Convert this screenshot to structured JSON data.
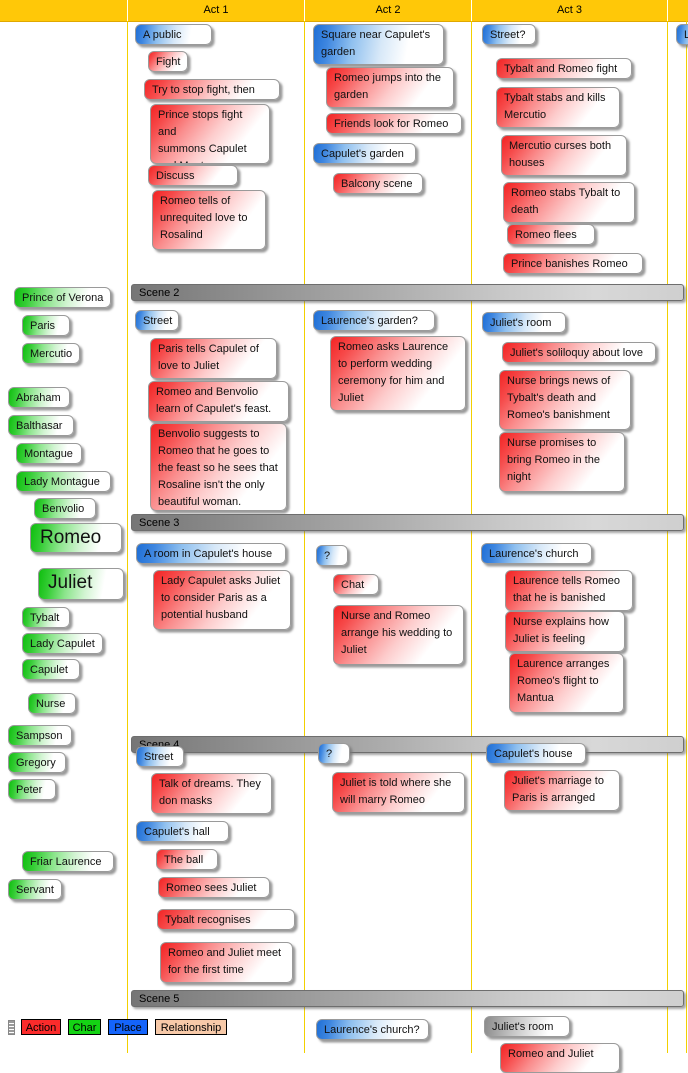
{
  "header": {
    "columns": [
      {
        "label": ""
      },
      {
        "label": "Act 1"
      },
      {
        "label": "Act 2"
      },
      {
        "label": "Act 3"
      },
      {
        "label": ""
      }
    ]
  },
  "scene_bars": [
    {
      "label": "Scene 2"
    },
    {
      "label": "Scene 3"
    },
    {
      "label": "Scene 4"
    },
    {
      "label": "Scene 5"
    }
  ],
  "characters": [
    {
      "label": "Prince of Verona"
    },
    {
      "label": "Paris"
    },
    {
      "label": "Mercutio"
    },
    {
      "label": "Abraham"
    },
    {
      "label": "Balthasar"
    },
    {
      "label": "Montague"
    },
    {
      "label": "Lady Montague"
    },
    {
      "label": "Benvolio"
    },
    {
      "label": "Romeo"
    },
    {
      "label": "Juliet"
    },
    {
      "label": "Tybalt"
    },
    {
      "label": "Lady Capulet"
    },
    {
      "label": "Capulet"
    },
    {
      "label": "Nurse"
    },
    {
      "label": "Sampson"
    },
    {
      "label": "Gregory"
    },
    {
      "label": "Peter"
    },
    {
      "label": "Friar Laurence"
    },
    {
      "label": "Servant"
    }
  ],
  "act1": {
    "scene1": [
      {
        "label": "A public place"
      },
      {
        "label": "Fight"
      },
      {
        "label": "Try to stop fight, then fight"
      },
      {
        "label": "Prince stops fight and\nsummons Capulet\nand Montague"
      },
      {
        "label": "Discuss Romeo"
      },
      {
        "label": "Romeo tells of\nunrequited love to\nRosalind"
      }
    ],
    "scene2": [
      {
        "label": "Street"
      },
      {
        "label": "Paris tells Capulet of\nlove to Juliet"
      },
      {
        "label": "Romeo and Benvolio\nlearn of Capulet's feast."
      },
      {
        "label": "Benvolio suggests to\nRomeo that he goes to\nthe feast so he sees that\nRosaline isn't the only\nbeautiful woman."
      }
    ],
    "scene3": [
      {
        "label": "A room in Capulet's house"
      },
      {
        "label": "Lady Capulet asks Juliet\nto consider Paris as a\npotential husband"
      }
    ],
    "scene4": [
      {
        "label": "Street"
      },
      {
        "label": "Talk of dreams. They\ndon masks"
      },
      {
        "label": "Capulet's hall"
      },
      {
        "label": "The ball"
      },
      {
        "label": "Romeo sees Juliet"
      },
      {
        "label": "Tybalt recognises Romeo"
      },
      {
        "label": "Romeo and Juliet meet\nfor the first time"
      }
    ]
  },
  "act2": {
    "scene1": [
      {
        "label": "Square near Capulet's\ngarden"
      },
      {
        "label": "Romeo jumps into the\ngarden"
      },
      {
        "label": "Friends look for Romeo"
      },
      {
        "label": "Capulet's garden"
      },
      {
        "label": "Balcony scene"
      }
    ],
    "scene2": [
      {
        "label": "Laurence's garden?"
      },
      {
        "label": "Romeo asks Laurence\nto perform wedding\nceremony for him and\nJuliet"
      }
    ],
    "scene3": [
      {
        "label": "?"
      },
      {
        "label": "Chat"
      },
      {
        "label": "Nurse and Romeo\narrange his wedding to\nJuliet"
      }
    ],
    "scene4": [
      {
        "label": "?"
      },
      {
        "label": "Juliet is told where she\nwill marry Romeo"
      }
    ],
    "scene5": [
      {
        "label": "Laurence's church?"
      }
    ]
  },
  "act3": {
    "scene1": [
      {
        "label": "Street?"
      },
      {
        "label": "Tybalt and Romeo fight"
      },
      {
        "label": "Tybalt stabs and kills\nMercutio"
      },
      {
        "label": "Mercutio curses both\nhouses"
      },
      {
        "label": "Romeo stabs Tybalt to\ndeath"
      },
      {
        "label": "Romeo flees"
      },
      {
        "label": "Prince banishes Romeo"
      }
    ],
    "scene2": [
      {
        "label": "Juliet's room"
      },
      {
        "label": "Juliet's soliloquy about love"
      },
      {
        "label": "Nurse brings news of\nTybalt's death and\nRomeo's banishment"
      },
      {
        "label": "Nurse promises to\nbring Romeo in the\nnight"
      }
    ],
    "scene3": [
      {
        "label": "Laurence's church"
      },
      {
        "label": "Laurence tells Romeo\nthat he is banished"
      },
      {
        "label": "Nurse explains how\nJuliet is feeling"
      },
      {
        "label": "Laurence arranges\nRomeo's flight to\nMantua"
      }
    ],
    "scene4": [
      {
        "label": "Capulet's house"
      },
      {
        "label": "Juliet's marriage to\nParis is arranged"
      }
    ],
    "scene5": [
      {
        "label": "Juliet's room"
      },
      {
        "label": "Romeo and Juliet"
      }
    ]
  },
  "act4": {
    "scene1": [
      {
        "label": "La"
      }
    ]
  },
  "legend": {
    "items": [
      {
        "label": "Action",
        "color": "#FB2B2B"
      },
      {
        "label": "Char",
        "color": "#14D314"
      },
      {
        "label": "Place",
        "color": "#1464FB"
      },
      {
        "label": "Relationship",
        "color": "#F7C9A8"
      }
    ]
  }
}
